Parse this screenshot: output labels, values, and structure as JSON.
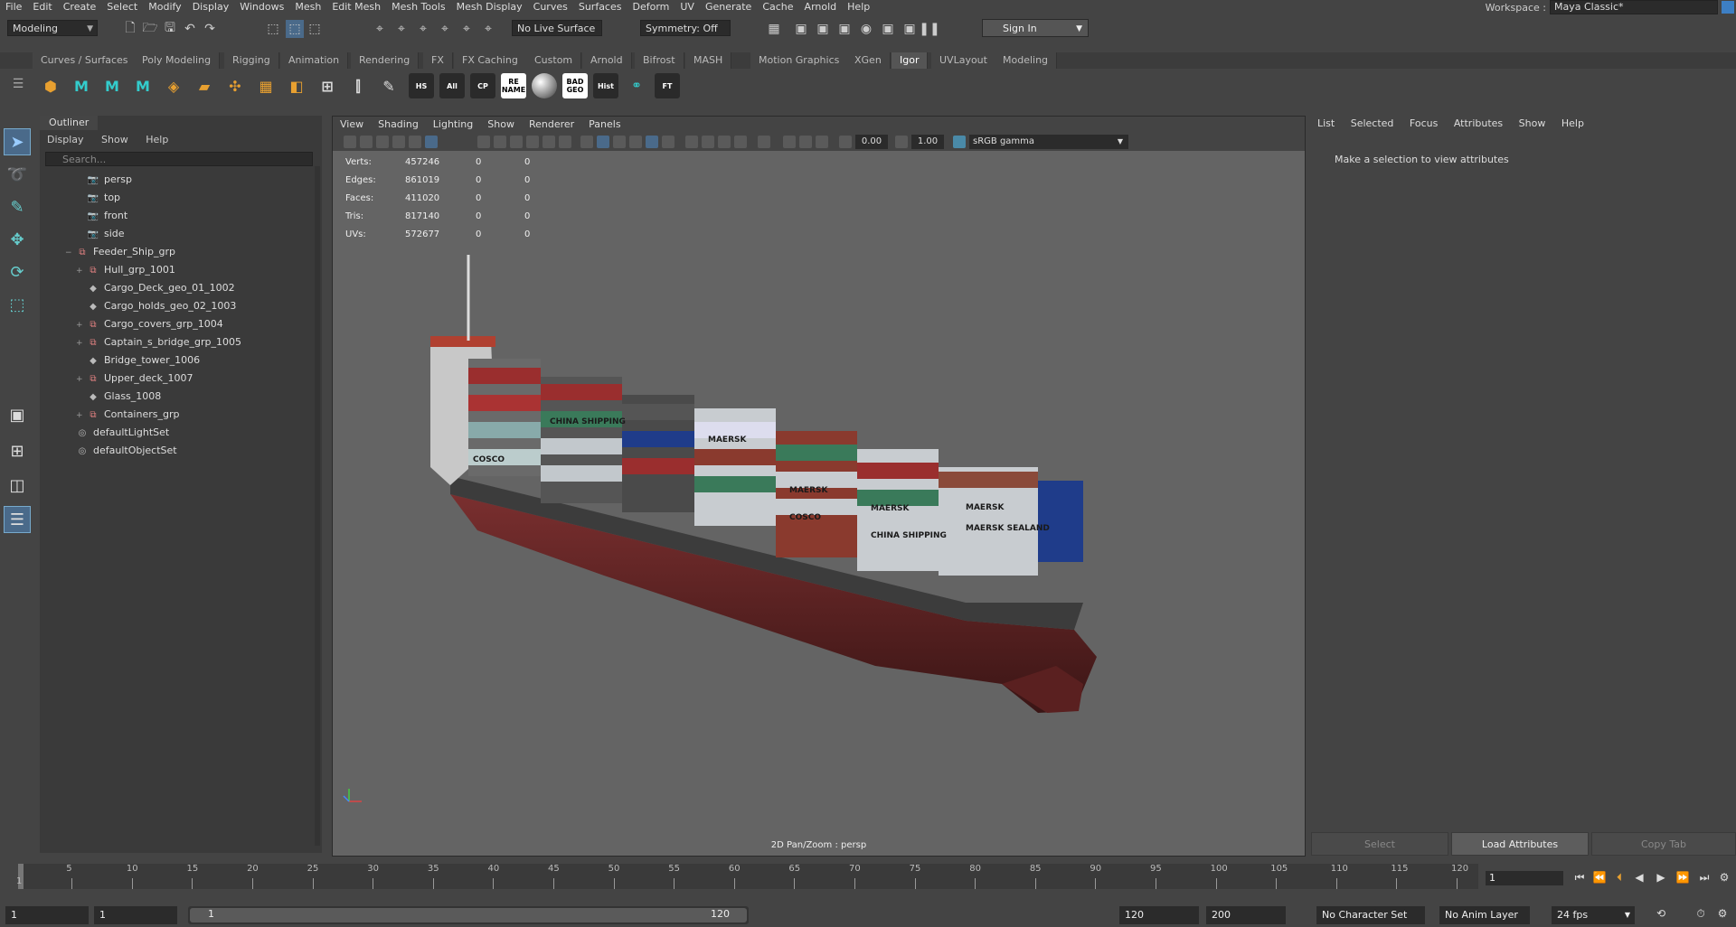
{
  "menubar": {
    "items": [
      "File",
      "Edit",
      "Create",
      "Select",
      "Modify",
      "Display",
      "Windows",
      "Mesh",
      "Edit Mesh",
      "Mesh Tools",
      "Mesh Display",
      "Curves",
      "Surfaces",
      "Deform",
      "UV",
      "Generate",
      "Cache",
      "Arnold",
      "Help"
    ],
    "workspace_label": "Workspace :",
    "workspace_value": "Maya Classic*"
  },
  "statusline": {
    "mode": "Modeling",
    "live_surface": "No Live Surface",
    "symmetry": "Symmetry: Off",
    "sign_in": "Sign In"
  },
  "shelf": {
    "tabs": [
      "Curves / Surfaces",
      "Poly Modeling",
      "Rigging",
      "Animation",
      "Rendering",
      "FX",
      "FX Caching",
      "Custom",
      "Arnold",
      "Bifrost",
      "MASH",
      "Motion Graphics",
      "XGen",
      "Igor",
      "UVLayout",
      "Modeling"
    ],
    "active_tab": "Igor",
    "labeled_icons": [
      "HS",
      "All",
      "CP",
      "RE NAME",
      "",
      "BAD GEO",
      "Hist",
      "FT"
    ]
  },
  "outliner": {
    "title": "Outliner",
    "menu": [
      "Display",
      "Show",
      "Help"
    ],
    "search_placeholder": "Search...",
    "items": [
      {
        "label": "persp",
        "icon": "camera-icon",
        "indent": 1,
        "expand": ""
      },
      {
        "label": "top",
        "icon": "camera-icon",
        "indent": 1,
        "expand": ""
      },
      {
        "label": "front",
        "icon": "camera-icon",
        "indent": 1,
        "expand": ""
      },
      {
        "label": "side",
        "icon": "camera-icon",
        "indent": 1,
        "expand": ""
      },
      {
        "label": "Feeder_Ship_grp",
        "icon": "group-icon",
        "indent": 0,
        "expand": "−"
      },
      {
        "label": "Hull_grp_1001",
        "icon": "group-icon",
        "indent": 1,
        "expand": "+"
      },
      {
        "label": "Cargo_Deck_geo_01_1002",
        "icon": "mesh-icon",
        "indent": 1,
        "expand": ""
      },
      {
        "label": "Cargo_holds_geo_02_1003",
        "icon": "mesh-icon",
        "indent": 1,
        "expand": ""
      },
      {
        "label": "Cargo_covers_grp_1004",
        "icon": "group-icon",
        "indent": 1,
        "expand": "+"
      },
      {
        "label": "Captain_s_bridge_grp_1005",
        "icon": "group-icon",
        "indent": 1,
        "expand": "+"
      },
      {
        "label": "Bridge_tower_1006",
        "icon": "mesh-icon",
        "indent": 1,
        "expand": ""
      },
      {
        "label": "Upper_deck_1007",
        "icon": "group-icon",
        "indent": 1,
        "expand": "+"
      },
      {
        "label": "Glass_1008",
        "icon": "mesh-icon",
        "indent": 1,
        "expand": ""
      },
      {
        "label": "Containers_grp",
        "icon": "group-icon",
        "indent": 1,
        "expand": "+"
      },
      {
        "label": "defaultLightSet",
        "icon": "set-icon",
        "indent": 0,
        "expand": ""
      },
      {
        "label": "defaultObjectSet",
        "icon": "set-icon",
        "indent": 0,
        "expand": ""
      }
    ]
  },
  "viewport": {
    "menu": [
      "View",
      "Shading",
      "Lighting",
      "Show",
      "Renderer",
      "Panels"
    ],
    "exposure": "0.00",
    "gamma": "1.00",
    "color_space": "sRGB gamma",
    "hud": [
      {
        "label": "Verts:",
        "total": "457246",
        "sel": "0",
        "comp": "0"
      },
      {
        "label": "Edges:",
        "total": "861019",
        "sel": "0",
        "comp": "0"
      },
      {
        "label": "Faces:",
        "total": "411020",
        "sel": "0",
        "comp": "0"
      },
      {
        "label": "Tris:",
        "total": "817140",
        "sel": "0",
        "comp": "0"
      },
      {
        "label": "UVs:",
        "total": "572677",
        "sel": "0",
        "comp": "0"
      }
    ],
    "camera_label": "2D Pan/Zoom : persp",
    "container_brands": [
      "MAERSK",
      "MAERSK",
      "MAERSK",
      "MAERSK",
      "COSCO",
      "COSCO",
      "CHINA SHIPPING",
      "CHINA SHIPPING",
      "MAERSK SEALAND"
    ]
  },
  "attribute_editor": {
    "menu": [
      "List",
      "Selected",
      "Focus",
      "Attributes",
      "Show",
      "Help"
    ],
    "message": "Make a selection to view attributes",
    "buttons": {
      "select": "Select",
      "load": "Load Attributes",
      "copy": "Copy Tab"
    }
  },
  "timeline": {
    "ticks": [
      "5",
      "10",
      "15",
      "20",
      "25",
      "30",
      "35",
      "40",
      "45",
      "50",
      "55",
      "60",
      "65",
      "70",
      "75",
      "80",
      "85",
      "90",
      "95",
      "100",
      "105",
      "110",
      "115",
      "120"
    ],
    "start_marker": "1",
    "current_frame": "1"
  },
  "range": {
    "start": "1",
    "anim_start": "1",
    "range_start": "1",
    "range_end": "120",
    "end": "120",
    "anim_end": "200",
    "character_set": "No Character Set",
    "anim_layer": "No Anim Layer",
    "fps": "24 fps"
  }
}
